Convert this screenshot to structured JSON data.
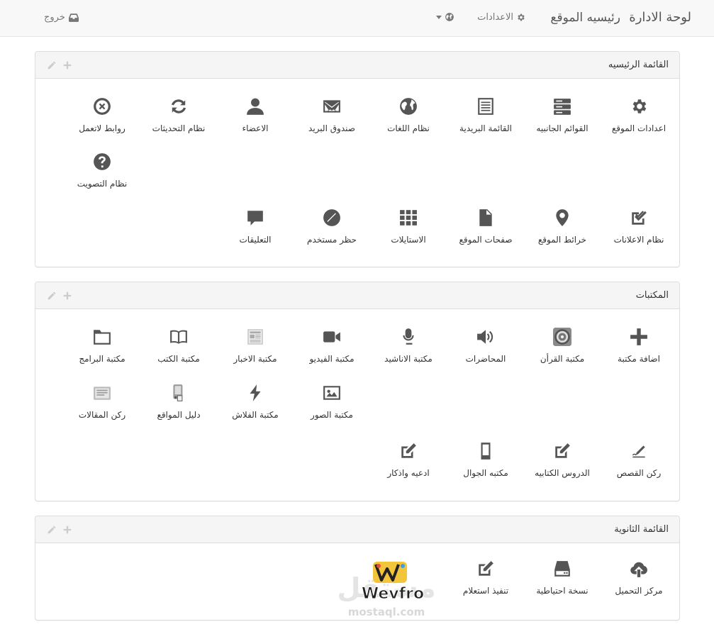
{
  "navbar": {
    "brand": "لوحة الادارة",
    "home": "رئيسيه الموقع",
    "settings": "الاعدادات",
    "logout": "خروج"
  },
  "panels": [
    {
      "title": "القائمة الرئيسيه",
      "items": [
        {
          "label": "اعدادات الموقع",
          "icon": "gear-icon"
        },
        {
          "label": "القوائم الجانبيه",
          "icon": "server-icon"
        },
        {
          "label": "القائمة البريدية",
          "icon": "list-alt-icon"
        },
        {
          "label": "نظام اللغات",
          "icon": "globe-icon"
        },
        {
          "label": "صندوق البريد",
          "icon": "envelope-icon"
        },
        {
          "label": "الاعضاء",
          "icon": "user-icon"
        },
        {
          "label": "نظام التحديثات",
          "icon": "refresh-icon"
        },
        {
          "label": "روابط لاتعمل",
          "icon": "remove-circle-icon"
        },
        {
          "label": "نظام التصويت",
          "icon": "question-circle-icon"
        },
        {
          "label": "نظام الاعلانات",
          "icon": "check-square-icon"
        },
        {
          "label": "خرائط الموقع",
          "icon": "map-marker-icon"
        },
        {
          "label": "صفحات الموقع",
          "icon": "file-icon"
        },
        {
          "label": "الاستايلات",
          "icon": "th-icon"
        },
        {
          "label": "حظر مستخدم",
          "icon": "ban-icon"
        },
        {
          "label": "التعليقات",
          "icon": "comment-icon"
        }
      ]
    },
    {
      "title": "المكتبات",
      "items": [
        {
          "label": "اضافة مكتبة",
          "icon": "plus-icon"
        },
        {
          "label": "مكتبة القرأن",
          "icon": "quran-icon"
        },
        {
          "label": "المحاضرات",
          "icon": "volume-icon"
        },
        {
          "label": "مكتبة الاناشيد",
          "icon": "microphone-icon"
        },
        {
          "label": "مكتبة الفيديو",
          "icon": "video-camera-icon"
        },
        {
          "label": "مكتبة الاخبار",
          "icon": "newspaper-icon"
        },
        {
          "label": "مكتبة الكتب",
          "icon": "book-open-icon"
        },
        {
          "label": "مكتبة البرامج",
          "icon": "folder-icon"
        },
        {
          "label": "مكتبة الصور",
          "icon": "picture-icon"
        },
        {
          "label": "مكتبة الفلاش",
          "icon": "flash-icon"
        },
        {
          "label": "دليل المواقع",
          "icon": "directory-icon"
        },
        {
          "label": "ركن المقالات",
          "icon": "articles-icon"
        },
        {
          "label": "ركن القصص",
          "icon": "pen-sign-icon"
        },
        {
          "label": "الدروس الكتابيه",
          "icon": "edit-icon"
        },
        {
          "label": "مكتبه الجوال",
          "icon": "mobile-icon"
        },
        {
          "label": "ادعيه واذكار",
          "icon": "edit-icon"
        }
      ]
    },
    {
      "title": "القائمة الثانوية",
      "items": [
        {
          "label": "مركز التحميل",
          "icon": "cloud-upload-icon"
        },
        {
          "label": "نسخة احتياطية",
          "icon": "hdd-icon"
        },
        {
          "label": "تنفيذ استعلام",
          "icon": "edit-icon"
        }
      ]
    }
  ],
  "watermark": {
    "text_latin": "Wevfro",
    "text_arabic": "مستقل",
    "site": "mostaql.com"
  }
}
